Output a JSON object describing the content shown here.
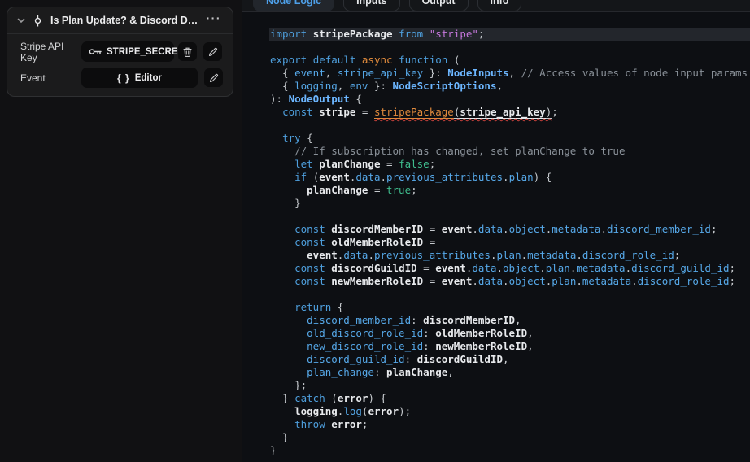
{
  "left_panel": {
    "title": "Is Plan Update? & Discord D…",
    "menu_glyph": "···",
    "fields": [
      {
        "label": "Stripe API Key",
        "value": "STRIPE_SECRE…",
        "icon": "key-icon",
        "actions": [
          "delete",
          "edit"
        ]
      },
      {
        "label": "Event",
        "value_prefix": "{ }",
        "value": "Editor",
        "icon": "braces-icon",
        "actions": [
          "edit"
        ]
      }
    ]
  },
  "tabs": {
    "active": "Node Logic",
    "items": [
      {
        "label": "Node Logic",
        "active": true
      },
      {
        "label": "Inputs",
        "active": false
      },
      {
        "label": "Output",
        "active": false
      },
      {
        "label": "Info",
        "active": false
      }
    ]
  },
  "editor": {
    "language": "typescript",
    "highlighted_line": 1,
    "lines": [
      [
        [
          "kw",
          "import"
        ],
        [
          "pln",
          " "
        ],
        [
          "name",
          "stripePackage"
        ],
        [
          "pln",
          " "
        ],
        [
          "kw",
          "from"
        ],
        [
          "pln",
          " "
        ],
        [
          "str",
          "\"stripe\""
        ],
        [
          "pun",
          ";"
        ]
      ],
      [],
      [
        [
          "kw",
          "export"
        ],
        [
          "pln",
          " "
        ],
        [
          "kw",
          "default"
        ],
        [
          "pln",
          " "
        ],
        [
          "orn",
          "async"
        ],
        [
          "pln",
          " "
        ],
        [
          "kw",
          "function"
        ],
        [
          "pun",
          " ("
        ]
      ],
      [
        [
          "pun",
          "  { "
        ],
        [
          "prp",
          "event"
        ],
        [
          "pun",
          ", "
        ],
        [
          "prp",
          "stripe_api_key"
        ],
        [
          "pun",
          " }: "
        ],
        [
          "typ",
          "NodeInputs"
        ],
        [
          "pun",
          ","
        ],
        [
          "com",
          " // Access values of node input params"
        ]
      ],
      [
        [
          "pun",
          "  { "
        ],
        [
          "prp",
          "logging"
        ],
        [
          "pun",
          ", "
        ],
        [
          "prp",
          "env"
        ],
        [
          "pun",
          " }: "
        ],
        [
          "typ",
          "NodeScriptOptions"
        ],
        [
          "pun",
          ","
        ]
      ],
      [
        [
          "pun",
          "): "
        ],
        [
          "typ",
          "NodeOutput"
        ],
        [
          "pun",
          " {"
        ]
      ],
      [
        [
          "pln",
          "  "
        ],
        [
          "kw",
          "const"
        ],
        [
          "pln",
          " "
        ],
        [
          "name",
          "stripe"
        ],
        [
          "pun",
          " = "
        ],
        [
          "orn u err",
          "stripePackage"
        ],
        [
          "pun u err",
          "("
        ],
        [
          "name u err",
          "stripe_api_key"
        ],
        [
          "pun u err",
          ")"
        ],
        [
          "pun",
          ";"
        ]
      ],
      [],
      [
        [
          "pln",
          "  "
        ],
        [
          "kw",
          "try"
        ],
        [
          "pun",
          " {"
        ]
      ],
      [
        [
          "com",
          "    // If subscription has changed, set planChange to true"
        ]
      ],
      [
        [
          "pln",
          "    "
        ],
        [
          "kw",
          "let"
        ],
        [
          "pln",
          " "
        ],
        [
          "name",
          "planChange"
        ],
        [
          "pun",
          " = "
        ],
        [
          "bool",
          "false"
        ],
        [
          "pun",
          ";"
        ]
      ],
      [
        [
          "pln",
          "    "
        ],
        [
          "kw",
          "if"
        ],
        [
          "pun",
          " ("
        ],
        [
          "name",
          "event"
        ],
        [
          "pun",
          "."
        ],
        [
          "prp",
          "data"
        ],
        [
          "pun",
          "."
        ],
        [
          "prp",
          "previous_attributes"
        ],
        [
          "pun",
          "."
        ],
        [
          "prp",
          "plan"
        ],
        [
          "pun",
          ") {"
        ]
      ],
      [
        [
          "pln",
          "      "
        ],
        [
          "name",
          "planChange"
        ],
        [
          "pun",
          " = "
        ],
        [
          "bool",
          "true"
        ],
        [
          "pun",
          ";"
        ]
      ],
      [
        [
          "pun",
          "    }"
        ]
      ],
      [],
      [
        [
          "pln",
          "    "
        ],
        [
          "kw",
          "const"
        ],
        [
          "pln",
          " "
        ],
        [
          "name",
          "discordMemberID"
        ],
        [
          "pun",
          " = "
        ],
        [
          "name",
          "event"
        ],
        [
          "pun",
          "."
        ],
        [
          "prp",
          "data"
        ],
        [
          "pun",
          "."
        ],
        [
          "prp",
          "object"
        ],
        [
          "pun",
          "."
        ],
        [
          "prp",
          "metadata"
        ],
        [
          "pun",
          "."
        ],
        [
          "prp",
          "discord_member_id"
        ],
        [
          "pun",
          ";"
        ]
      ],
      [
        [
          "pln",
          "    "
        ],
        [
          "kw",
          "const"
        ],
        [
          "pln",
          " "
        ],
        [
          "name",
          "oldMemberRoleID"
        ],
        [
          "pun",
          " ="
        ]
      ],
      [
        [
          "pln",
          "      "
        ],
        [
          "name",
          "event"
        ],
        [
          "pun",
          "."
        ],
        [
          "prp",
          "data"
        ],
        [
          "pun",
          "."
        ],
        [
          "prp",
          "previous_attributes"
        ],
        [
          "pun",
          "."
        ],
        [
          "prp",
          "plan"
        ],
        [
          "pun",
          "."
        ],
        [
          "prp",
          "metadata"
        ],
        [
          "pun",
          "."
        ],
        [
          "prp",
          "discord_role_id"
        ],
        [
          "pun",
          ";"
        ]
      ],
      [
        [
          "pln",
          "    "
        ],
        [
          "kw",
          "const"
        ],
        [
          "pln",
          " "
        ],
        [
          "name",
          "discordGuildID"
        ],
        [
          "pun",
          " = "
        ],
        [
          "name",
          "event"
        ],
        [
          "pun",
          "."
        ],
        [
          "prp",
          "data"
        ],
        [
          "pun",
          "."
        ],
        [
          "prp",
          "object"
        ],
        [
          "pun",
          "."
        ],
        [
          "prp",
          "plan"
        ],
        [
          "pun",
          "."
        ],
        [
          "prp",
          "metadata"
        ],
        [
          "pun",
          "."
        ],
        [
          "prp",
          "discord_guild_id"
        ],
        [
          "pun",
          ";"
        ]
      ],
      [
        [
          "pln",
          "    "
        ],
        [
          "kw",
          "const"
        ],
        [
          "pln",
          " "
        ],
        [
          "name",
          "newMemberRoleID"
        ],
        [
          "pun",
          " = "
        ],
        [
          "name",
          "event"
        ],
        [
          "pun",
          "."
        ],
        [
          "prp",
          "data"
        ],
        [
          "pun",
          "."
        ],
        [
          "prp",
          "object"
        ],
        [
          "pun",
          "."
        ],
        [
          "prp",
          "plan"
        ],
        [
          "pun",
          "."
        ],
        [
          "prp",
          "metadata"
        ],
        [
          "pun",
          "."
        ],
        [
          "prp",
          "discord_role_id"
        ],
        [
          "pun",
          ";"
        ]
      ],
      [],
      [
        [
          "pln",
          "    "
        ],
        [
          "kw",
          "return"
        ],
        [
          "pun",
          " {"
        ]
      ],
      [
        [
          "pln",
          "      "
        ],
        [
          "prp",
          "discord_member_id"
        ],
        [
          "pun",
          ": "
        ],
        [
          "name",
          "discordMemberID"
        ],
        [
          "pun",
          ","
        ]
      ],
      [
        [
          "pln",
          "      "
        ],
        [
          "prp",
          "old_discord_role_id"
        ],
        [
          "pun",
          ": "
        ],
        [
          "name",
          "oldMemberRoleID"
        ],
        [
          "pun",
          ","
        ]
      ],
      [
        [
          "pln",
          "      "
        ],
        [
          "prp",
          "new_discord_role_id"
        ],
        [
          "pun",
          ": "
        ],
        [
          "name",
          "newMemberRoleID"
        ],
        [
          "pun",
          ","
        ]
      ],
      [
        [
          "pln",
          "      "
        ],
        [
          "prp",
          "discord_guild_id"
        ],
        [
          "pun",
          ": "
        ],
        [
          "name",
          "discordGuildID"
        ],
        [
          "pun",
          ","
        ]
      ],
      [
        [
          "pln",
          "      "
        ],
        [
          "prp",
          "plan_change"
        ],
        [
          "pun",
          ": "
        ],
        [
          "name",
          "planChange"
        ],
        [
          "pun",
          ","
        ]
      ],
      [
        [
          "pun",
          "    };"
        ]
      ],
      [
        [
          "pun",
          "  } "
        ],
        [
          "kw",
          "catch"
        ],
        [
          "pun",
          " ("
        ],
        [
          "name",
          "error"
        ],
        [
          "pun",
          ") {"
        ]
      ],
      [
        [
          "pln",
          "    "
        ],
        [
          "name",
          "logging"
        ],
        [
          "pun",
          "."
        ],
        [
          "prp",
          "log"
        ],
        [
          "pun",
          "("
        ],
        [
          "name",
          "error"
        ],
        [
          "pun",
          ");"
        ]
      ],
      [
        [
          "pln",
          "    "
        ],
        [
          "kw",
          "throw"
        ],
        [
          "pln",
          " "
        ],
        [
          "name",
          "error"
        ],
        [
          "pun",
          ";"
        ]
      ],
      [
        [
          "pun",
          "  }"
        ]
      ],
      [
        [
          "pun",
          "}"
        ]
      ]
    ]
  },
  "colors": {
    "accent_blue": "#4D9FE8",
    "keyword": "#4E9FDD",
    "property": "#56A8E8",
    "identifier": "#E8EAED",
    "type": "#6CB6FF",
    "string": "#C678DD",
    "comment": "#8A9199",
    "boolean": "#3FBC8D",
    "orange": "#E08A3C",
    "punctuation": "#C6CACE",
    "error_underline": "#C9403A",
    "editor_bg": "#0D0F13",
    "line_highlight": "#23262C",
    "panel_bg": "#1B1B1C",
    "pill_bg": "#0C0C0D"
  }
}
